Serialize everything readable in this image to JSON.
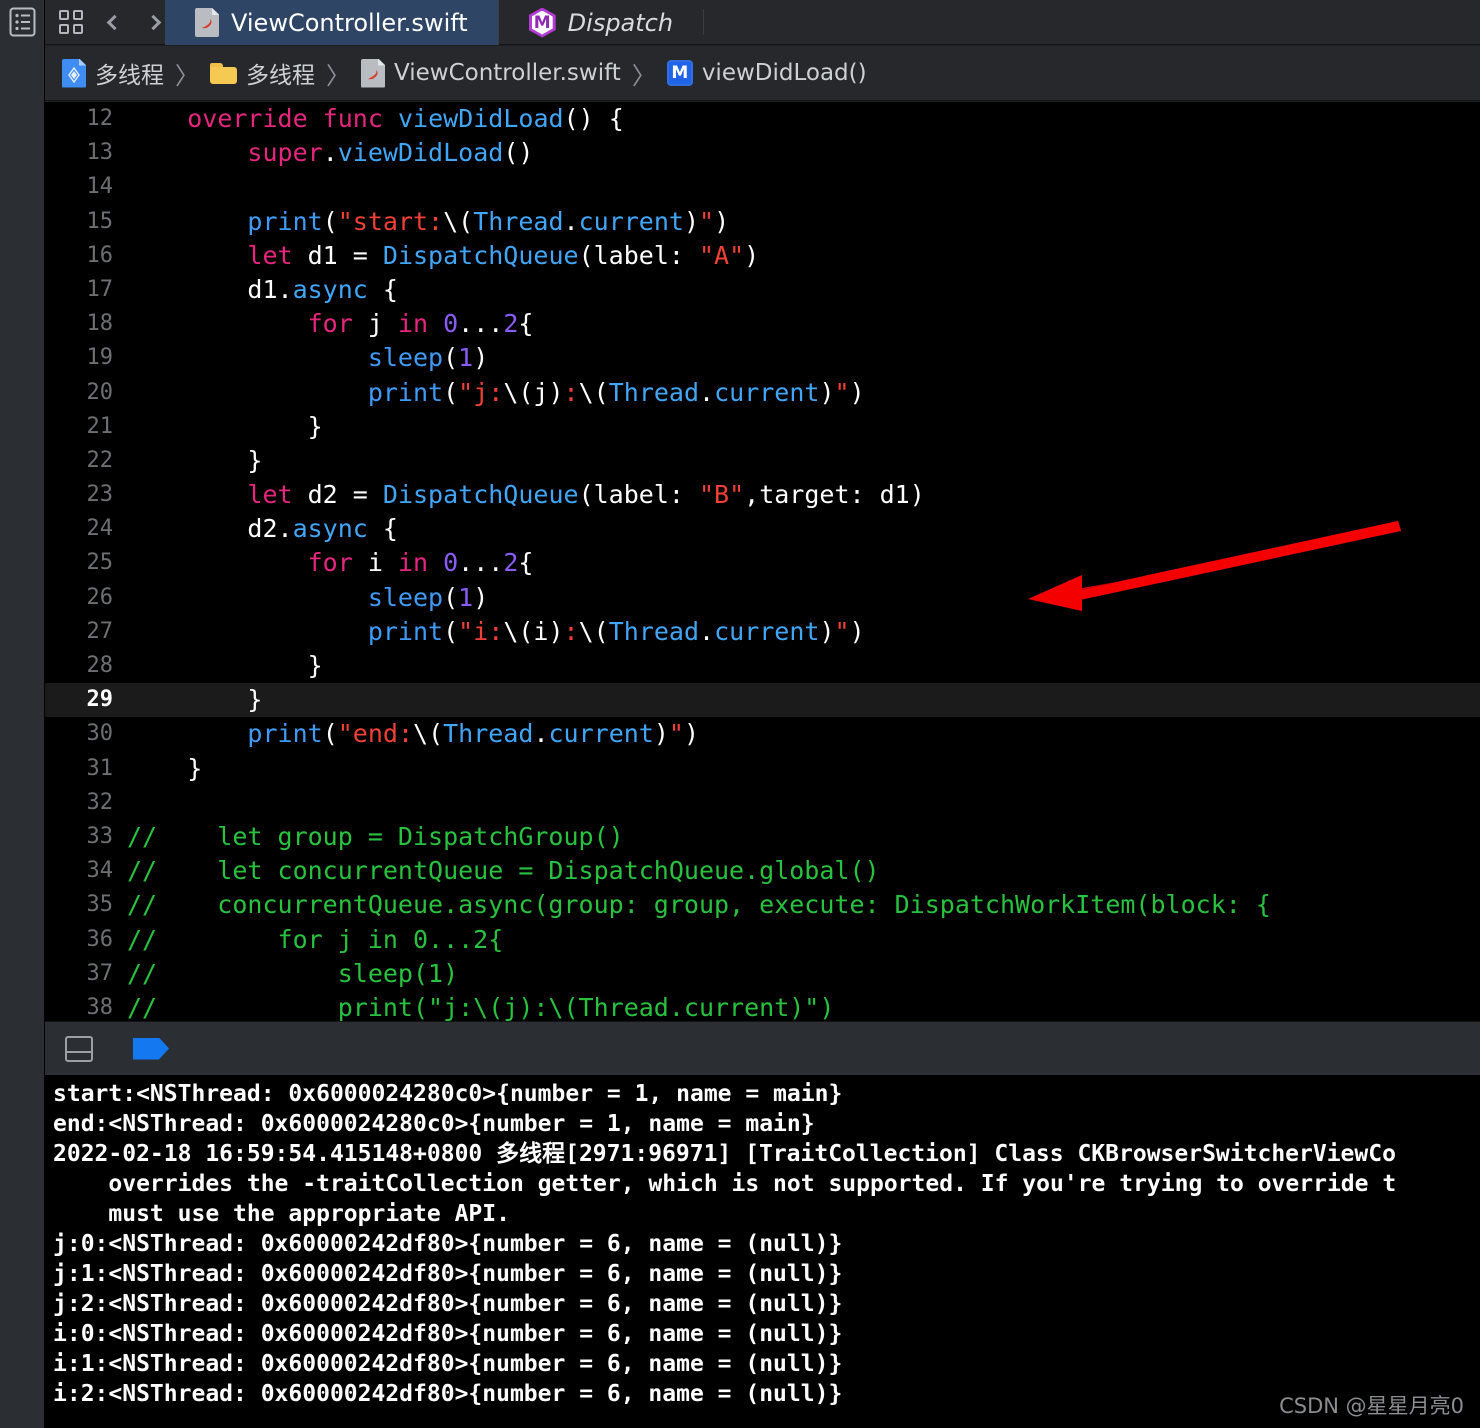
{
  "window": {
    "left_rail_icon": "navigator-list-icon"
  },
  "toolbar": {
    "grid_icon": "grid-tabs-icon",
    "back_icon": "chevron-left-icon",
    "forward_icon": "chevron-right-icon"
  },
  "tabs": [
    {
      "label": "ViewController.swift",
      "icon": "swift-file-icon",
      "active": true,
      "italic": false
    },
    {
      "label": "Dispatch",
      "icon": "module-hex-icon",
      "active": false,
      "italic": true
    }
  ],
  "breadcrumb": {
    "separator": "〉",
    "items": [
      {
        "label": "多线程",
        "icon": "xcode-project-icon"
      },
      {
        "label": "多线程",
        "icon": "folder-icon"
      },
      {
        "label": "ViewController.swift",
        "icon": "swift-file-icon"
      },
      {
        "label": "viewDidLoad()",
        "icon": "method-m-badge"
      }
    ]
  },
  "editor": {
    "current_line": 29,
    "first_line": 12,
    "lines": [
      {
        "n": 12,
        "tokens": [
          {
            "t": "    ",
            "c": "p"
          },
          {
            "t": "override",
            "c": "k"
          },
          {
            "t": " ",
            "c": "p"
          },
          {
            "t": "func",
            "c": "k"
          },
          {
            "t": " ",
            "c": "p"
          },
          {
            "t": "viewDidLoad",
            "c": "t"
          },
          {
            "t": "() {",
            "c": "p"
          }
        ]
      },
      {
        "n": 13,
        "tokens": [
          {
            "t": "        ",
            "c": "p"
          },
          {
            "t": "super",
            "c": "k"
          },
          {
            "t": ".",
            "c": "p"
          },
          {
            "t": "viewDidLoad",
            "c": "t"
          },
          {
            "t": "()",
            "c": "p"
          }
        ]
      },
      {
        "n": 14,
        "tokens": [
          {
            "t": "",
            "c": "p"
          }
        ]
      },
      {
        "n": 15,
        "tokens": [
          {
            "t": "        ",
            "c": "p"
          },
          {
            "t": "print",
            "c": "f"
          },
          {
            "t": "(",
            "c": "p"
          },
          {
            "t": "\"start:",
            "c": "s"
          },
          {
            "t": "\\(",
            "c": "p"
          },
          {
            "t": "Thread",
            "c": "t"
          },
          {
            "t": ".",
            "c": "p"
          },
          {
            "t": "current",
            "c": "t"
          },
          {
            "t": ")",
            "c": "p"
          },
          {
            "t": "\"",
            "c": "s"
          },
          {
            "t": ")",
            "c": "p"
          }
        ]
      },
      {
        "n": 16,
        "tokens": [
          {
            "t": "        ",
            "c": "p"
          },
          {
            "t": "let",
            "c": "k"
          },
          {
            "t": " d1 = ",
            "c": "p"
          },
          {
            "t": "DispatchQueue",
            "c": "t"
          },
          {
            "t": "(label: ",
            "c": "p"
          },
          {
            "t": "\"A\"",
            "c": "s"
          },
          {
            "t": ")",
            "c": "p"
          }
        ]
      },
      {
        "n": 17,
        "tokens": [
          {
            "t": "        d1.",
            "c": "p"
          },
          {
            "t": "async",
            "c": "t"
          },
          {
            "t": " {",
            "c": "p"
          }
        ]
      },
      {
        "n": 18,
        "tokens": [
          {
            "t": "            ",
            "c": "p"
          },
          {
            "t": "for",
            "c": "k"
          },
          {
            "t": " j ",
            "c": "p"
          },
          {
            "t": "in",
            "c": "k"
          },
          {
            "t": " ",
            "c": "p"
          },
          {
            "t": "0",
            "c": "n"
          },
          {
            "t": "...",
            "c": "p"
          },
          {
            "t": "2",
            "c": "n"
          },
          {
            "t": "{",
            "c": "p"
          }
        ]
      },
      {
        "n": 19,
        "tokens": [
          {
            "t": "                ",
            "c": "p"
          },
          {
            "t": "sleep",
            "c": "f"
          },
          {
            "t": "(",
            "c": "p"
          },
          {
            "t": "1",
            "c": "n"
          },
          {
            "t": ")",
            "c": "p"
          }
        ]
      },
      {
        "n": 20,
        "tokens": [
          {
            "t": "                ",
            "c": "p"
          },
          {
            "t": "print",
            "c": "f"
          },
          {
            "t": "(",
            "c": "p"
          },
          {
            "t": "\"j:",
            "c": "s"
          },
          {
            "t": "\\(",
            "c": "p"
          },
          {
            "t": "j",
            "c": "p"
          },
          {
            "t": ")",
            "c": "p"
          },
          {
            "t": ":",
            "c": "s"
          },
          {
            "t": "\\(",
            "c": "p"
          },
          {
            "t": "Thread",
            "c": "t"
          },
          {
            "t": ".",
            "c": "p"
          },
          {
            "t": "current",
            "c": "t"
          },
          {
            "t": ")",
            "c": "p"
          },
          {
            "t": "\"",
            "c": "s"
          },
          {
            "t": ")",
            "c": "p"
          }
        ]
      },
      {
        "n": 21,
        "tokens": [
          {
            "t": "            }",
            "c": "p"
          }
        ]
      },
      {
        "n": 22,
        "tokens": [
          {
            "t": "        }",
            "c": "p"
          }
        ]
      },
      {
        "n": 23,
        "tokens": [
          {
            "t": "        ",
            "c": "p"
          },
          {
            "t": "let",
            "c": "k"
          },
          {
            "t": " d2 = ",
            "c": "p"
          },
          {
            "t": "DispatchQueue",
            "c": "t"
          },
          {
            "t": "(label: ",
            "c": "p"
          },
          {
            "t": "\"B\"",
            "c": "s"
          },
          {
            "t": ",target: d1)",
            "c": "p"
          }
        ]
      },
      {
        "n": 24,
        "tokens": [
          {
            "t": "        d2.",
            "c": "p"
          },
          {
            "t": "async",
            "c": "t"
          },
          {
            "t": " {",
            "c": "p"
          }
        ]
      },
      {
        "n": 25,
        "tokens": [
          {
            "t": "            ",
            "c": "p"
          },
          {
            "t": "for",
            "c": "k"
          },
          {
            "t": " i ",
            "c": "p"
          },
          {
            "t": "in",
            "c": "k"
          },
          {
            "t": " ",
            "c": "p"
          },
          {
            "t": "0",
            "c": "n"
          },
          {
            "t": "...",
            "c": "p"
          },
          {
            "t": "2",
            "c": "n"
          },
          {
            "t": "{",
            "c": "p"
          }
        ]
      },
      {
        "n": 26,
        "tokens": [
          {
            "t": "                ",
            "c": "p"
          },
          {
            "t": "sleep",
            "c": "f"
          },
          {
            "t": "(",
            "c": "p"
          },
          {
            "t": "1",
            "c": "n"
          },
          {
            "t": ")",
            "c": "p"
          }
        ]
      },
      {
        "n": 27,
        "tokens": [
          {
            "t": "                ",
            "c": "p"
          },
          {
            "t": "print",
            "c": "f"
          },
          {
            "t": "(",
            "c": "p"
          },
          {
            "t": "\"i:",
            "c": "s"
          },
          {
            "t": "\\(",
            "c": "p"
          },
          {
            "t": "i",
            "c": "p"
          },
          {
            "t": ")",
            "c": "p"
          },
          {
            "t": ":",
            "c": "s"
          },
          {
            "t": "\\(",
            "c": "p"
          },
          {
            "t": "Thread",
            "c": "t"
          },
          {
            "t": ".",
            "c": "p"
          },
          {
            "t": "current",
            "c": "t"
          },
          {
            "t": ")",
            "c": "p"
          },
          {
            "t": "\"",
            "c": "s"
          },
          {
            "t": ")",
            "c": "p"
          }
        ]
      },
      {
        "n": 28,
        "tokens": [
          {
            "t": "            }",
            "c": "p"
          }
        ]
      },
      {
        "n": 29,
        "tokens": [
          {
            "t": "        }",
            "c": "p"
          }
        ]
      },
      {
        "n": 30,
        "tokens": [
          {
            "t": "        ",
            "c": "p"
          },
          {
            "t": "print",
            "c": "f"
          },
          {
            "t": "(",
            "c": "p"
          },
          {
            "t": "\"end:",
            "c": "s"
          },
          {
            "t": "\\(",
            "c": "p"
          },
          {
            "t": "Thread",
            "c": "t"
          },
          {
            "t": ".",
            "c": "p"
          },
          {
            "t": "current",
            "c": "t"
          },
          {
            "t": ")",
            "c": "p"
          },
          {
            "t": "\"",
            "c": "s"
          },
          {
            "t": ")",
            "c": "p"
          }
        ]
      },
      {
        "n": 31,
        "tokens": [
          {
            "t": "    }",
            "c": "p"
          }
        ]
      },
      {
        "n": 32,
        "tokens": [
          {
            "t": "",
            "c": "p"
          }
        ]
      },
      {
        "n": 33,
        "tokens": [
          {
            "t": "//    let group = DispatchGroup()",
            "c": "c"
          }
        ]
      },
      {
        "n": 34,
        "tokens": [
          {
            "t": "//    let concurrentQueue = DispatchQueue.global()",
            "c": "c"
          }
        ]
      },
      {
        "n": 35,
        "tokens": [
          {
            "t": "//    concurrentQueue.async(group: group, execute: DispatchWorkItem(block: {",
            "c": "c"
          }
        ]
      },
      {
        "n": 36,
        "tokens": [
          {
            "t": "//        for j in 0...2{",
            "c": "c"
          }
        ]
      },
      {
        "n": 37,
        "tokens": [
          {
            "t": "//            sleep(1)",
            "c": "c"
          }
        ]
      },
      {
        "n": 38,
        "tokens": [
          {
            "t": "//            print(\"j:\\(j):\\(Thread.current)\")",
            "c": "c"
          }
        ]
      }
    ],
    "annotation_arrow": {
      "color": "#f50000",
      "points_to_line": 23
    }
  },
  "debug_toolbar": {
    "split_icon": "split-pane-icon",
    "flag_icon": "filter-flag-icon",
    "flag_color": "#1478f0"
  },
  "console": {
    "lines": [
      "start:<NSThread: 0x6000024280c0>{number = 1, name = main}",
      "end:<NSThread: 0x6000024280c0>{number = 1, name = main}",
      "2022-02-18 16:59:54.415148+0800 多线程[2971:96971] [TraitCollection] Class CKBrowserSwitcherViewCo",
      "    overrides the -traitCollection getter, which is not supported. If you're trying to override t",
      "    must use the appropriate API.",
      "j:0:<NSThread: 0x60000242df80>{number = 6, name = (null)}",
      "j:1:<NSThread: 0x60000242df80>{number = 6, name = (null)}",
      "j:2:<NSThread: 0x60000242df80>{number = 6, name = (null)}",
      "i:0:<NSThread: 0x60000242df80>{number = 6, name = (null)}",
      "i:1:<NSThread: 0x60000242df80>{number = 6, name = (null)}",
      "i:2:<NSThread: 0x60000242df80>{number = 6, name = (null)}"
    ]
  },
  "watermark": {
    "text": "CSDN @星星月亮0"
  }
}
